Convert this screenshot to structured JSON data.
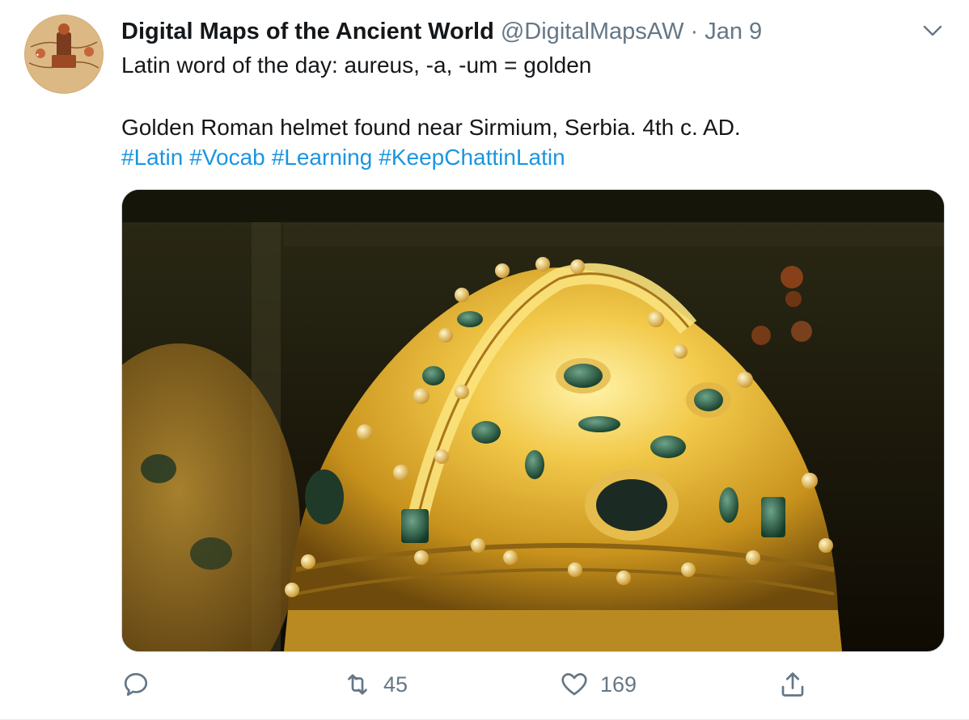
{
  "tweet": {
    "author_name": "Digital Maps of the Ancient World",
    "handle": "@DigitalMapsAW",
    "separator": "·",
    "date": "Jan 9",
    "line1": "Latin word of the day: aureus, -a, -um = golden",
    "line2": "Golden Roman helmet found near Sirmium, Serbia. 4th c. AD.",
    "hashtags": [
      "#Latin",
      "#Vocab",
      "#Learning",
      "#KeepChattinLatin"
    ],
    "avatar_icon": "map-medallion-icon",
    "media_alt": "photo-golden-roman-helmet"
  },
  "actions": {
    "reply_icon": "reply-icon",
    "retweet_icon": "retweet-icon",
    "retweet_count": "45",
    "like_icon": "heart-icon",
    "like_count": "169",
    "share_icon": "share-icon"
  },
  "colors": {
    "link": "#1b95e0",
    "secondary_text": "#657786",
    "primary_text": "#14171a",
    "border": "#e6ecf0"
  }
}
